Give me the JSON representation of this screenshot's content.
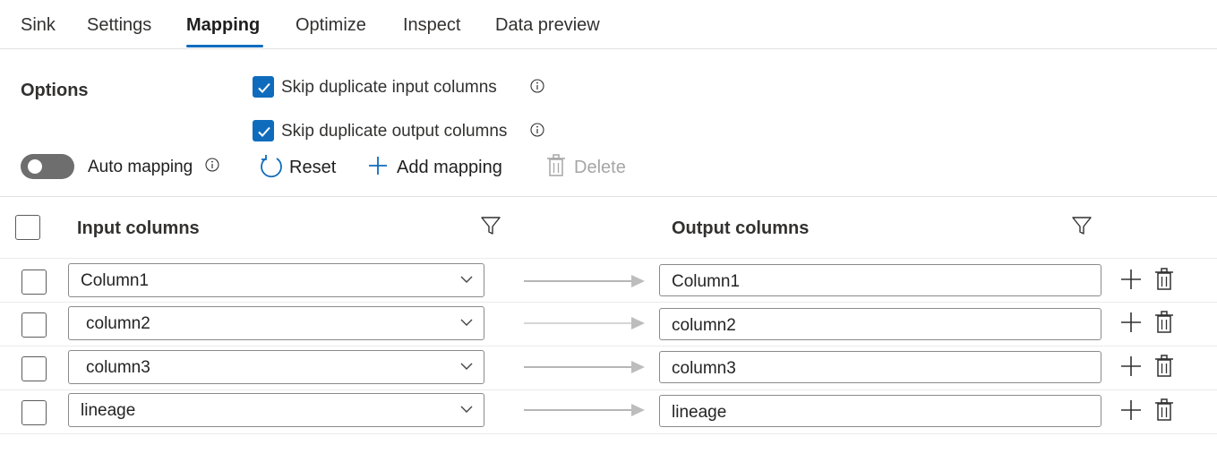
{
  "tabs": [
    {
      "label": "Sink",
      "active": false
    },
    {
      "label": "Settings",
      "active": false
    },
    {
      "label": "Mapping",
      "active": true
    },
    {
      "label": "Optimize",
      "active": false
    },
    {
      "label": "Inspect",
      "active": false
    },
    {
      "label": "Data preview",
      "active": false
    }
  ],
  "options": {
    "title": "Options",
    "skip_duplicate_input": {
      "label": "Skip duplicate input columns",
      "checked": true
    },
    "skip_duplicate_output": {
      "label": "Skip duplicate output columns",
      "checked": true
    }
  },
  "toolbar": {
    "auto_mapping": {
      "label": "Auto mapping",
      "enabled": false
    },
    "reset_label": "Reset",
    "add_mapping_label": "Add mapping",
    "delete_label": "Delete"
  },
  "table": {
    "input_header": "Input columns",
    "output_header": "Output columns",
    "rows": [
      {
        "input": "Column1",
        "output": "Column1",
        "selected": false
      },
      {
        "input": "column2",
        "output": "column2",
        "selected": false
      },
      {
        "input": "column3",
        "output": "column3",
        "selected": false
      },
      {
        "input": "lineage",
        "output": "lineage",
        "selected": false
      }
    ]
  },
  "colors": {
    "accent": "#0f6cbd",
    "toggle_off": "#6e6e6e",
    "disabled_text": "#a6a6a6"
  }
}
